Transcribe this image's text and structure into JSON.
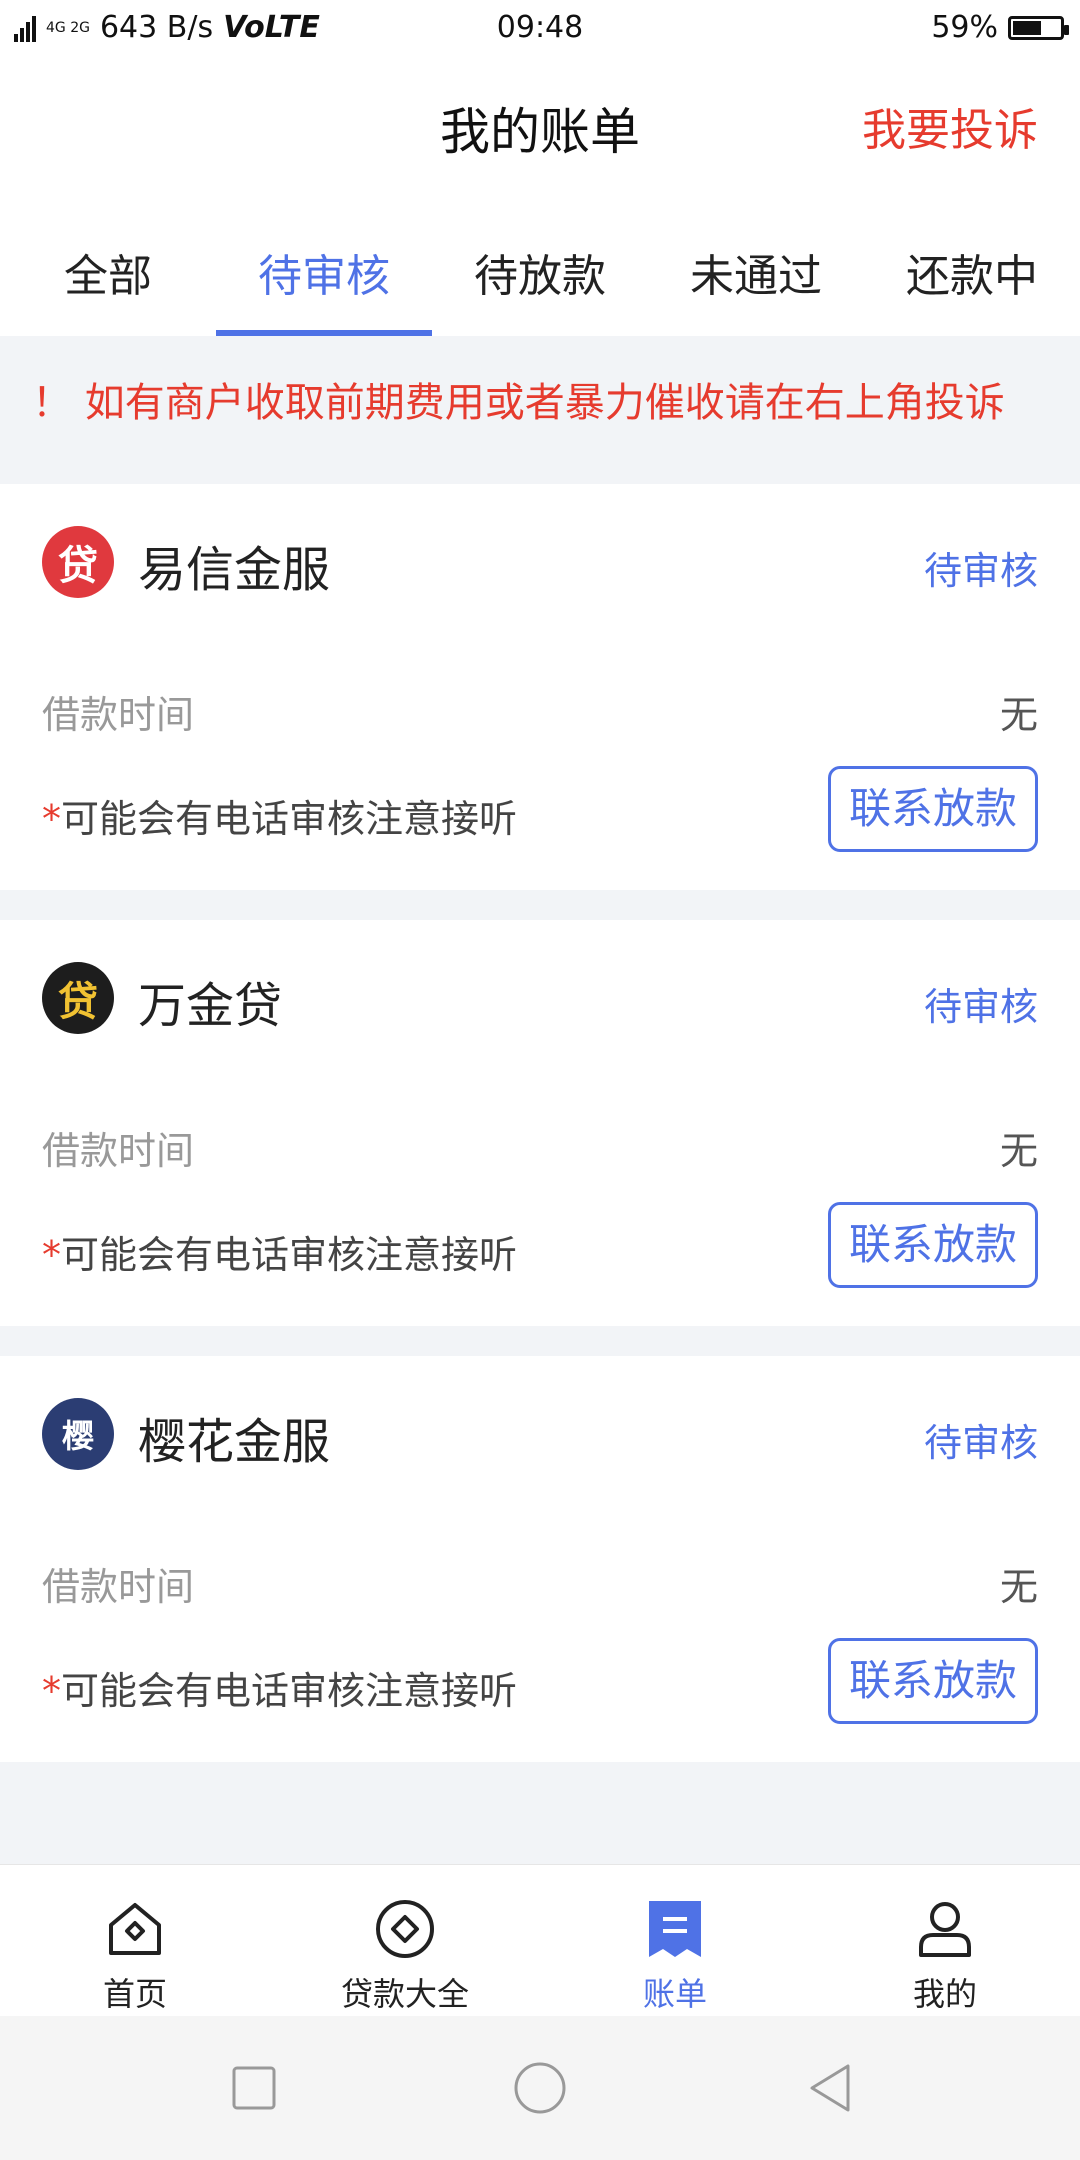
{
  "status_bar": {
    "network": "4G 2G",
    "speed": "643 B/s",
    "volte": "VoLTE",
    "time": "09:48",
    "battery": "59%"
  },
  "header": {
    "title": "我的账单",
    "complain_label": "我要投诉"
  },
  "tabs": [
    {
      "label": "全部",
      "active": false
    },
    {
      "label": "待审核",
      "active": true
    },
    {
      "label": "待放款",
      "active": false
    },
    {
      "label": "未通过",
      "active": false
    },
    {
      "label": "还款中",
      "active": false
    }
  ],
  "notice": {
    "text": "！ 如有商户收取前期费用或者暴力催收请在右上角投诉"
  },
  "loans": [
    {
      "logo_text": "贷",
      "logo_color": "#e0393e",
      "name": "易信金服",
      "status": "待审核",
      "time_label": "借款时间",
      "time_value": "无",
      "note_star": "*",
      "note_text": "可能会有电话审核注意接听",
      "button_label": "联系放款"
    },
    {
      "logo_text": "贷",
      "logo_color": "#1d1d1d",
      "name": "万金贷",
      "status": "待审核",
      "time_label": "借款时间",
      "time_value": "无",
      "note_star": "*",
      "note_text": "可能会有电话审核注意接听",
      "button_label": "联系放款"
    },
    {
      "logo_text": "樱",
      "logo_color": "#2b3d73",
      "name": "樱花金服",
      "status": "待审核",
      "time_label": "借款时间",
      "time_value": "无",
      "note_star": "*",
      "note_text": "可能会有电话审核注意接听",
      "button_label": "联系放款"
    }
  ],
  "bottom_nav": [
    {
      "label": "首页",
      "icon": "home-icon",
      "active": false
    },
    {
      "label": "贷款大全",
      "icon": "loans-icon",
      "active": false
    },
    {
      "label": "账单",
      "icon": "bill-icon",
      "active": true
    },
    {
      "label": "我的",
      "icon": "profile-icon",
      "active": false
    }
  ],
  "colors": {
    "accent": "#4f72e6",
    "warning": "#e63b2e"
  }
}
